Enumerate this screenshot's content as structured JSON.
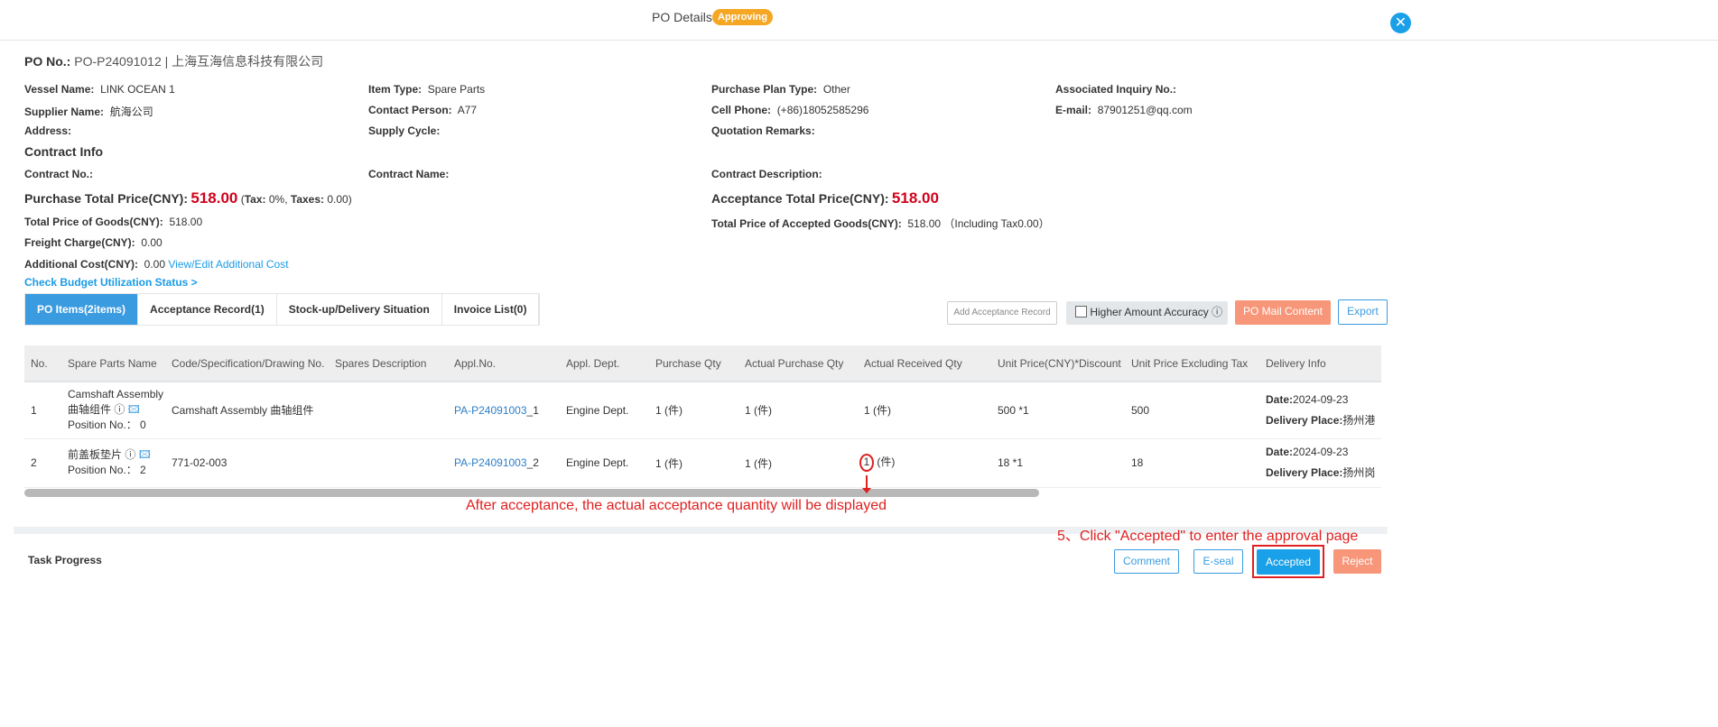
{
  "header": {
    "title": "PO Details",
    "status": "Approving",
    "close_icon": "close-icon"
  },
  "po": {
    "label": "PO No.:",
    "value": "PO-P24091012 | 上海互海信息科技有限公司"
  },
  "fields": {
    "vessel_label": "Vessel Name:",
    "vessel": "LINK OCEAN 1",
    "item_type_label": "Item Type:",
    "item_type": "Spare Parts",
    "plan_type_label": "Purchase Plan Type:",
    "plan_type": "Other",
    "inquiry_label": "Associated Inquiry No.:",
    "supplier_label": "Supplier Name:",
    "supplier": "航海公司",
    "contact_label": "Contact Person:",
    "contact": "A77",
    "cell_label": "Cell Phone:",
    "cell": "(+86)18052585296",
    "email_label": "E-mail:",
    "email": "87901251@qq.com",
    "address_label": "Address:",
    "supply_cycle_label": "Supply Cycle:",
    "quotation_label": "Quotation Remarks:"
  },
  "contract": {
    "heading": "Contract Info",
    "no_label": "Contract No.:",
    "name_label": "Contract Name:",
    "desc_label": "Contract Description:"
  },
  "totals": {
    "purchase_label": "Purchase Total Price(CNY):",
    "purchase": "518.00",
    "tax_open": "(",
    "tax_label": "Tax:",
    "tax": "0%,",
    "taxes_label": "Taxes:",
    "taxes": "0.00)",
    "acceptance_label": "Acceptance Total Price(CNY):",
    "acceptance": "518.00",
    "goods_label": "Total Price of Goods(CNY):",
    "goods": "518.00",
    "accepted_goods_label": "Total Price of Accepted Goods(CNY):",
    "accepted_goods": "518.00 （Including Tax0.00）",
    "freight_label": "Freight Charge(CNY):",
    "freight": "0.00",
    "additional_label": "Additional Cost(CNY):",
    "additional": "0.00",
    "additional_link": "View/Edit Additional Cost",
    "budget_link": "Check Budget Utilization Status >"
  },
  "tabs": [
    "PO Items(2items)",
    "Acceptance Record(1)",
    "Stock-up/Delivery Situation",
    "Invoice List(0)"
  ],
  "toolbar": {
    "add_acceptance": "Add Acceptance Record",
    "accuracy": "Higher Amount Accuracy",
    "mail": "PO Mail Content",
    "export": "Export"
  },
  "table": {
    "columns": [
      "No.",
      "Spare Parts Name",
      "Code/Specification/Drawing No.",
      "Spares Description",
      "Appl.No.",
      "Appl. Dept.",
      "Purchase Qty",
      "Actual Purchase Qty",
      "Actual Received Qty",
      "Unit Price(CNY)*Discount",
      "Unit Price Excluding Tax",
      "Delivery Info"
    ],
    "rows": [
      {
        "no": "1",
        "name": "Camshaft Assembly 曲轴组件",
        "position": "Position No.： 0",
        "code": "Camshaft Assembly 曲轴组件",
        "desc": "",
        "appl_link": "PA-P24091003",
        "appl_suffix": "_1",
        "dept": "Engine Dept.",
        "qty": "1 (件)",
        "actual_qty": "1 (件)",
        "received": "1",
        "received_unit": "(件)",
        "price": "500 *1",
        "excl": "500",
        "date_label": "Date:",
        "date": "2024-09-23",
        "place_label": "Delivery Place:",
        "place": "扬州港"
      },
      {
        "no": "2",
        "name": "前盖板垫片",
        "position": "Position No.： 2",
        "code": "771-02-003",
        "desc": "",
        "appl_link": "PA-P24091003",
        "appl_suffix": "_2",
        "dept": "Engine Dept.",
        "qty": "1 (件)",
        "actual_qty": "1 (件)",
        "received": "1",
        "received_unit": "(件)",
        "price": "18 *1",
        "excl": "18",
        "date_label": "Date:",
        "date": "2024-09-23",
        "place_label": "Delivery Place:",
        "place": "扬州岗"
      }
    ]
  },
  "annotations": {
    "qty_note": "After acceptance, the actual acceptance quantity will be displayed",
    "step5": "5、Click \"Accepted\" to enter the approval page"
  },
  "footer": {
    "task_progress": "Task Progress",
    "comment": "Comment",
    "eseal": "E-seal",
    "accepted": "Accepted",
    "reject": "Reject"
  }
}
